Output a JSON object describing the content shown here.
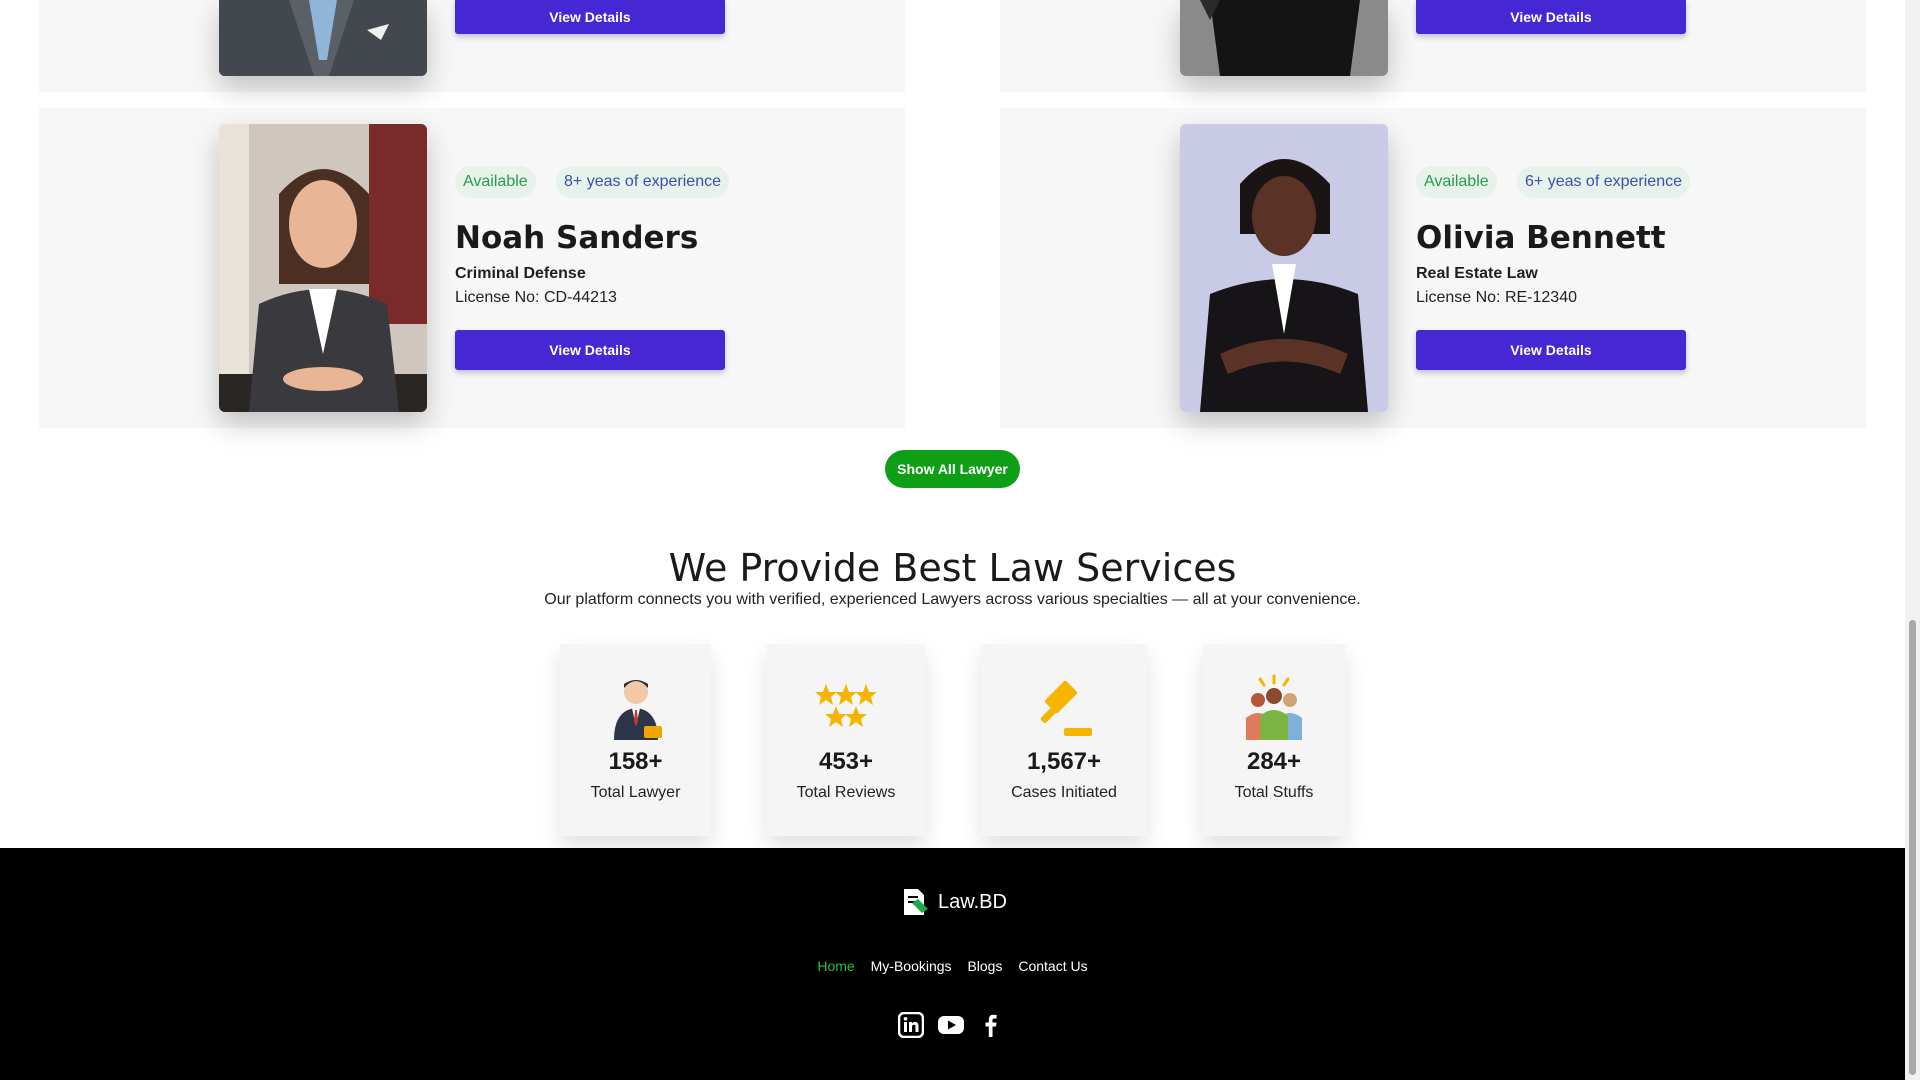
{
  "top_cards": [
    {
      "button": "View Details"
    },
    {
      "button": "View Details"
    }
  ],
  "lawyers": [
    {
      "status": "Available",
      "experience": "8+ yeas of experience",
      "name": "Noah Sanders",
      "specialty": "Criminal Defense",
      "license": "License No: CD-44213",
      "button": "View Details"
    },
    {
      "status": "Available",
      "experience": "6+ yeas of experience",
      "name": "Olivia Bennett",
      "specialty": "Real Estate Law",
      "license": "License No: RE-12340",
      "button": "View Details"
    }
  ],
  "show_all_label": "Show All Lawyer",
  "services": {
    "title": "We Provide Best Law Services",
    "subtitle": "Our platform connects you with verified, experienced Lawyers across various specialties — all at your convenience."
  },
  "stats": [
    {
      "value": "158+",
      "label": "Total Lawyer",
      "icon": "lawyer-icon"
    },
    {
      "value": "453+",
      "label": "Total Reviews",
      "icon": "stars-icon"
    },
    {
      "value": "1,567+",
      "label": "Cases Initiated",
      "icon": "gavel-icon"
    },
    {
      "value": "284+",
      "label": "Total Stuffs",
      "icon": "team-icon"
    }
  ],
  "footer": {
    "brand": "Law.BD",
    "nav": [
      "Home",
      "My-Bookings",
      "Blogs",
      "Contact Us"
    ],
    "social": [
      "linkedin-icon",
      "youtube-icon",
      "facebook-icon"
    ]
  },
  "colors": {
    "primary_button": "#4527d4",
    "green_button": "#0e9f16",
    "active_nav": "#2fbf3a",
    "card_bg": "#f7f7f7"
  }
}
